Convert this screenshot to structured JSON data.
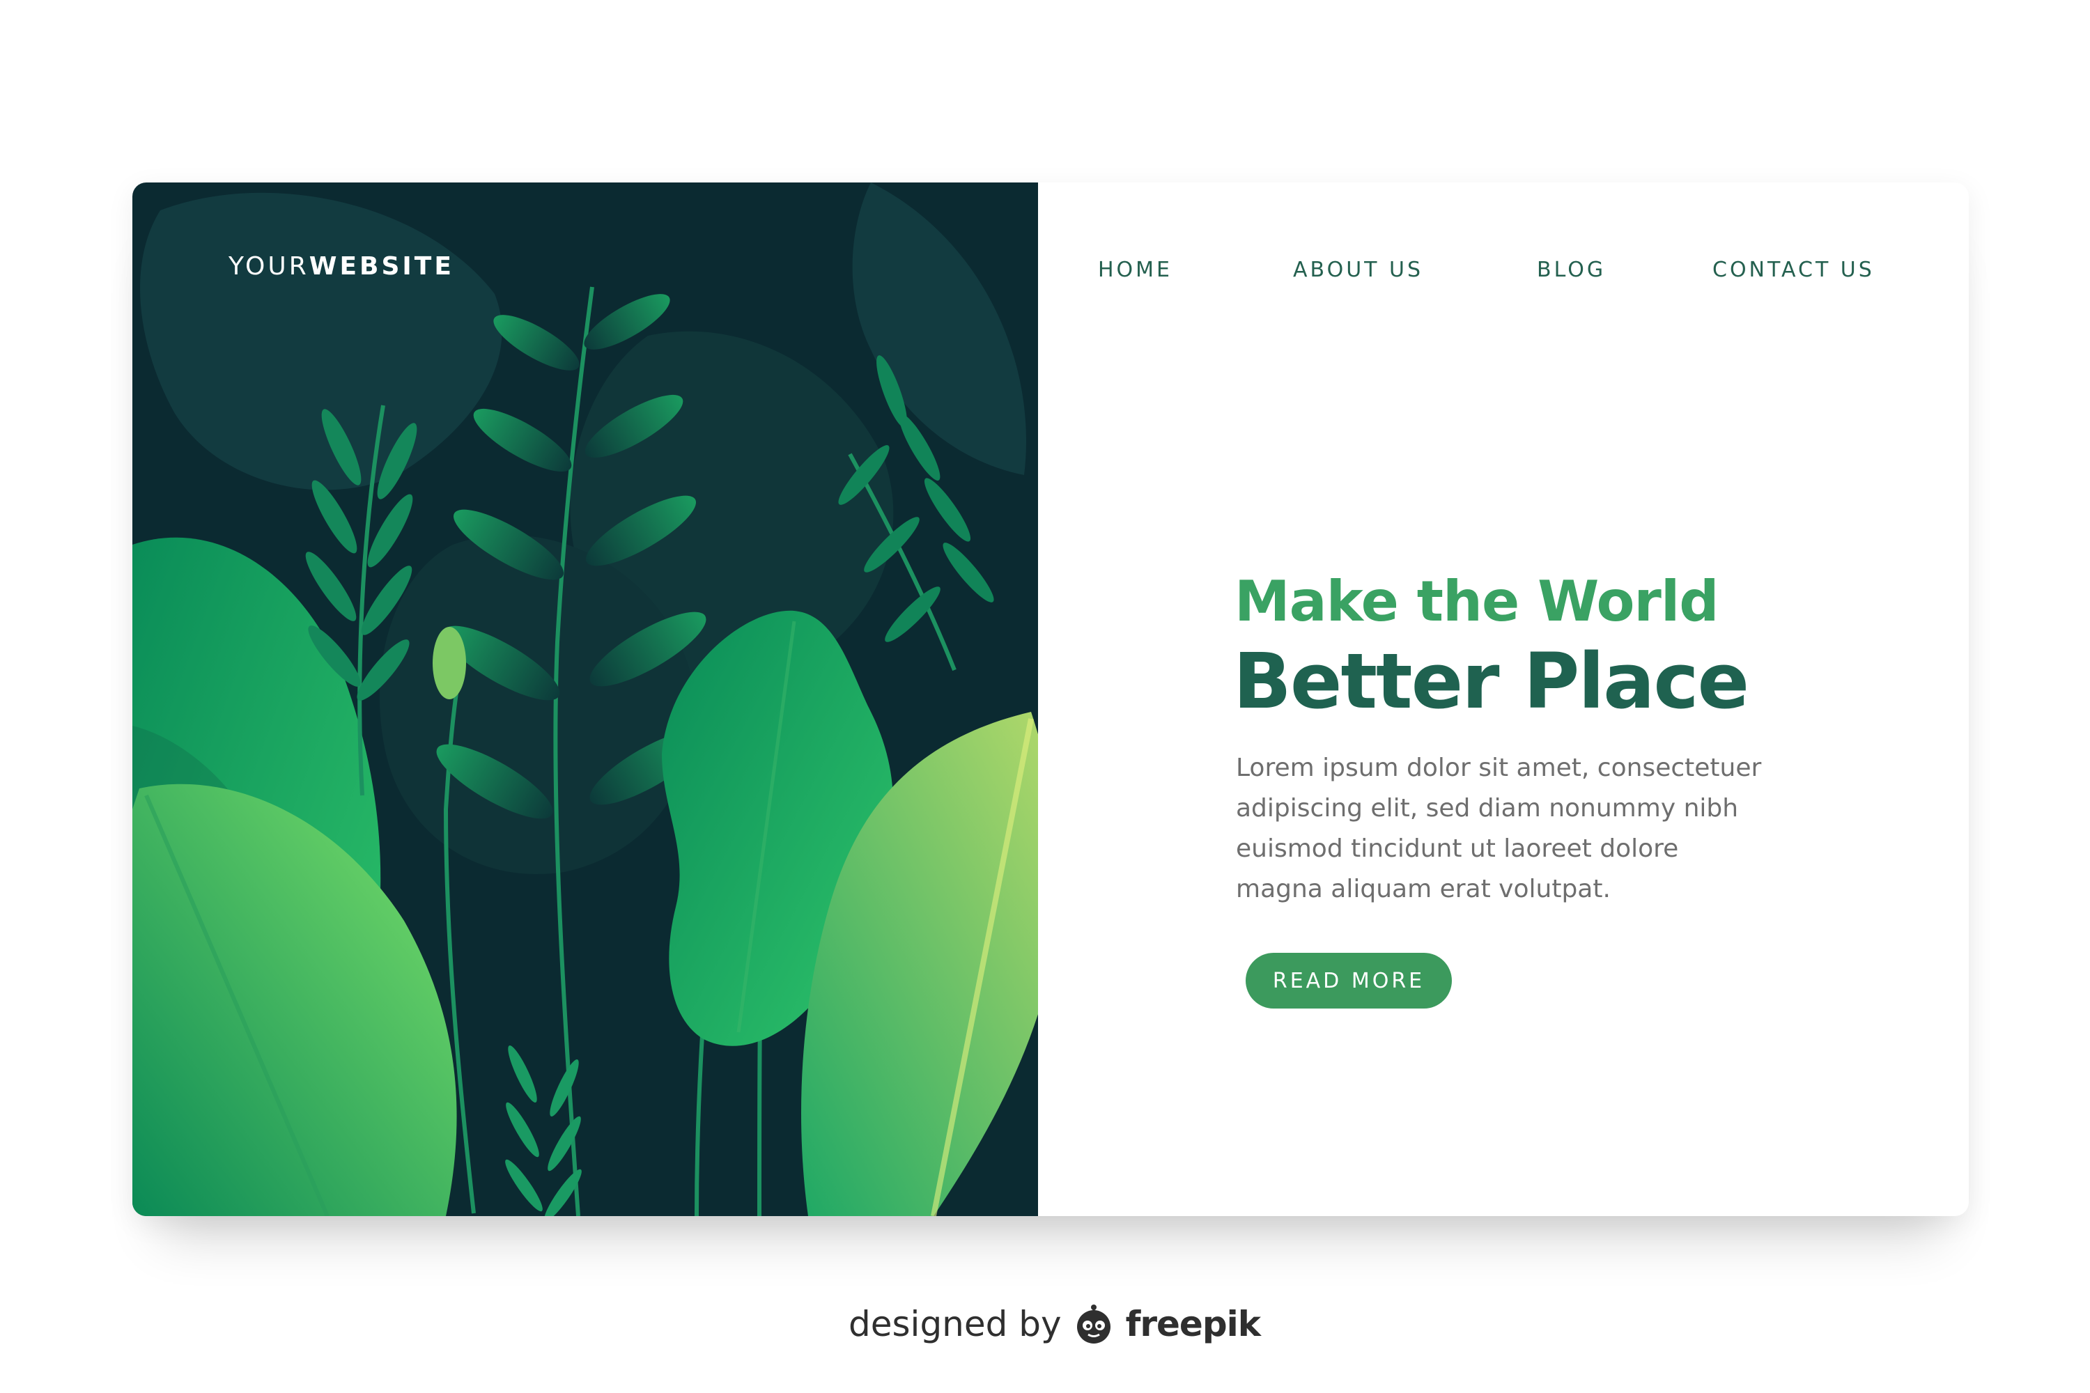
{
  "brand": {
    "logo_light": "YOUR",
    "logo_bold": "WEBSITE"
  },
  "nav": {
    "items": [
      {
        "label": "HOME"
      },
      {
        "label": "ABOUT US"
      },
      {
        "label": "BLOG"
      },
      {
        "label": "CONTACT US"
      }
    ]
  },
  "hero": {
    "headline_line1": "Make the World",
    "headline_line2": "Better Place",
    "body_lines": [
      "Lorem ipsum dolor sit amet, consectetuer",
      "adipiscing elit, sed diam nonummy nibh",
      "euismod tincidunt ut laoreet dolore",
      "magna aliquam erat volutpat."
    ],
    "cta_label": "READ MORE"
  },
  "credit": {
    "prefix": "designed by",
    "brand": "freepik"
  },
  "colors": {
    "panel_dark": "#0b2a31",
    "nav_text": "#24604f",
    "headline_light": "#3aa263",
    "headline_dark": "#1f6250",
    "button": "#3c9a5d",
    "body_text": "#6e6e6e"
  },
  "icons": [
    "monstera-leaf-illustration",
    "fern-illustration",
    "banana-leaf-illustration",
    "freepik-mascot-icon"
  ]
}
